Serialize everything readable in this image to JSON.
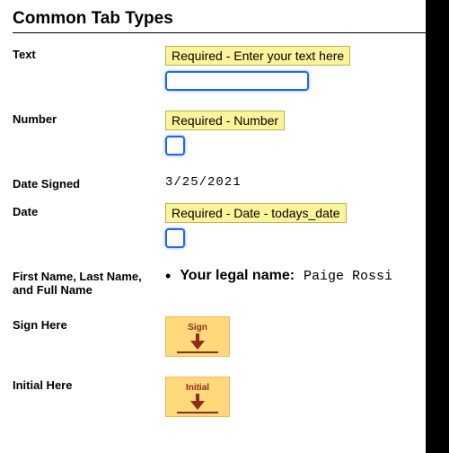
{
  "section_title": "Common Tab Types",
  "rows": {
    "text": {
      "label": "Text",
      "required_hint": "Required - Enter your text here"
    },
    "number": {
      "label": "Number",
      "required_hint": "Required - Number"
    },
    "date_signed": {
      "label": "Date Signed",
      "value": "3/25/2021"
    },
    "date": {
      "label": "Date",
      "required_hint": "Required - Date - todays_date"
    },
    "name": {
      "label": "First Name, Last Name, and Full Name",
      "legend_label": "Your legal name:",
      "value": "Paige Rossi"
    },
    "sign_here": {
      "label": "Sign Here",
      "tab_caption": "Sign"
    },
    "initial_here": {
      "label": "Initial Here",
      "tab_caption": "Initial"
    }
  }
}
